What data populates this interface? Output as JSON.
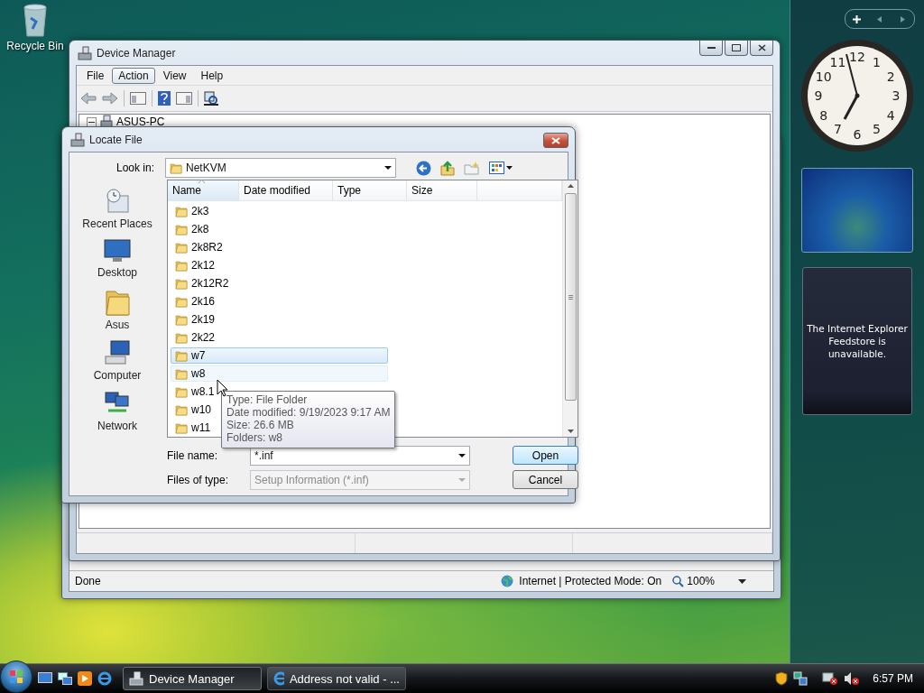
{
  "desktop": {
    "icons": [
      {
        "label": "Recycle Bin",
        "kind": "recycle"
      }
    ]
  },
  "browser_window": {
    "status_bar": {
      "status": "Done",
      "zone": "Internet | Protected Mode: On",
      "zoom": "100%"
    }
  },
  "device_manager": {
    "title": "Device Manager",
    "menu": [
      {
        "label": "File",
        "selected": false
      },
      {
        "label": "Action",
        "selected": true
      },
      {
        "label": "View",
        "selected": false
      },
      {
        "label": "Help",
        "selected": false
      }
    ],
    "tree": [
      {
        "label": "ASUS-PC",
        "expanded": true
      }
    ]
  },
  "dialog": {
    "title": "Locate File",
    "look_in_label": "Look in:",
    "look_in": "NetKVM",
    "places": [
      {
        "label": "Recent Places",
        "kind": "recent"
      },
      {
        "label": "Desktop",
        "kind": "desktop"
      },
      {
        "label": "Asus",
        "kind": "folder"
      },
      {
        "label": "Computer",
        "kind": "computer"
      },
      {
        "label": "Network",
        "kind": "network"
      }
    ],
    "columns": [
      {
        "label": "Name",
        "sorted": true
      },
      {
        "label": "Date modified",
        "sorted": false
      },
      {
        "label": "Type",
        "sorted": false
      },
      {
        "label": "Size",
        "sorted": false
      }
    ],
    "rows": [
      {
        "name": "2k3",
        "selected": false,
        "hovered": false
      },
      {
        "name": "2k8",
        "selected": false,
        "hovered": false
      },
      {
        "name": "2k8R2",
        "selected": false,
        "hovered": false
      },
      {
        "name": "2k12",
        "selected": false,
        "hovered": false
      },
      {
        "name": "2k12R2",
        "selected": false,
        "hovered": false
      },
      {
        "name": "2k16",
        "selected": false,
        "hovered": false
      },
      {
        "name": "2k19",
        "selected": false,
        "hovered": false
      },
      {
        "name": "2k22",
        "selected": false,
        "hovered": false
      },
      {
        "name": "w7",
        "selected": true,
        "hovered": false
      },
      {
        "name": "w8",
        "selected": false,
        "hovered": true
      },
      {
        "name": "w8.1",
        "selected": false,
        "hovered": false
      },
      {
        "name": "w10",
        "selected": false,
        "hovered": false
      },
      {
        "name": "w11",
        "selected": false,
        "hovered": false
      }
    ],
    "tooltip": [
      "Type: File Folder",
      "Date modified: 9/19/2023 9:17 AM",
      "Size: 26.6 MB",
      "Folders: w8"
    ],
    "file_name_label": "File name:",
    "file_name": "*.inf",
    "file_type_label": "Files of type:",
    "file_type": "Setup Information (*.inf)",
    "file_type_disabled": true,
    "buttons": [
      {
        "label": "Open",
        "kind": "default"
      },
      {
        "label": "Cancel",
        "kind": "normal"
      }
    ]
  },
  "taskbar": {
    "tasks": [
      {
        "label": "Device Manager",
        "kind": "device",
        "selected": true
      },
      {
        "label": "Address not valid - ...",
        "kind": "browser",
        "selected": false
      }
    ],
    "clock": "6:57 PM"
  },
  "sidebar": {
    "clock_numerals": [
      "11",
      "12",
      "1",
      "10",
      "2",
      "9",
      "3",
      "8",
      "4",
      "7",
      "6",
      "5"
    ],
    "feed_message": "The Internet Explorer Feedstore is unavailable."
  }
}
